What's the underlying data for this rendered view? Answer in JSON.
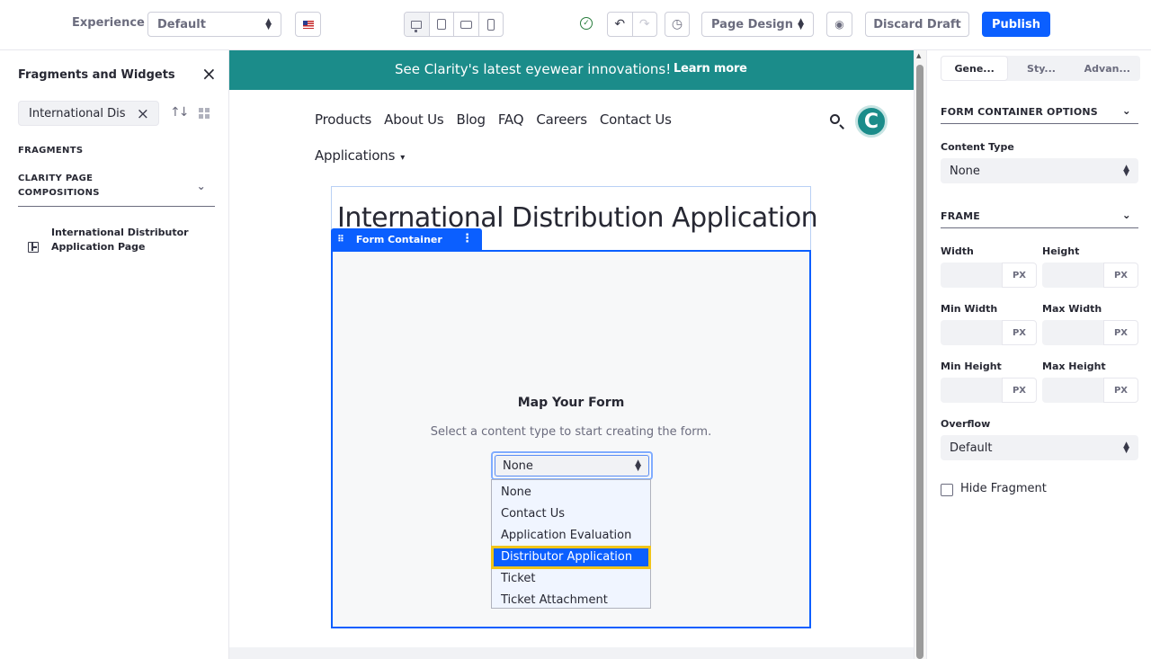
{
  "toolbar": {
    "experience_label": "Experience",
    "experience_value": "Default",
    "mode_value": "Page Design",
    "discard_label": "Discard Draft",
    "publish_label": "Publish",
    "accent": "#0b5fff"
  },
  "left_panel": {
    "title": "Fragments and Widgets",
    "search_value": "International Dis",
    "section": "FRAGMENTS",
    "collection": "CLARITY PAGE COMPOSITIONS",
    "item": "International Distributor Application Page"
  },
  "page": {
    "banner_text": "See Clarity's latest eyewear innovations!",
    "banner_link": "Learn more",
    "banner_color": "#1b8c8a",
    "nav": [
      "Products",
      "About Us",
      "Blog",
      "FAQ",
      "Careers",
      "Contact Us"
    ],
    "nav_dropdown": "Applications",
    "avatar_letter": "C",
    "heading": "International Distribution Application",
    "form_container_label": "Form Container",
    "map_title": "Map Your Form",
    "map_subtitle": "Select a content type to start creating the form.",
    "select_value": "None",
    "options": [
      "None",
      "Contact Us",
      "Application Evaluation",
      "Distributor Application",
      "Ticket",
      "Ticket Attachment"
    ],
    "highlighted_option": "Distributor Application"
  },
  "right_panel": {
    "tabs": [
      "Gene...",
      "Sty...",
      "Advan..."
    ],
    "section1": "FORM CONTAINER OPTIONS",
    "content_type_label": "Content Type",
    "content_type_value": "None",
    "section2": "FRAME",
    "width_label": "Width",
    "height_label": "Height",
    "min_width_label": "Min Width",
    "max_width_label": "Max Width",
    "min_height_label": "Min Height",
    "max_height_label": "Max Height",
    "unit": "PX",
    "overflow_label": "Overflow",
    "overflow_value": "Default",
    "hide_fragment_label": "Hide Fragment"
  }
}
